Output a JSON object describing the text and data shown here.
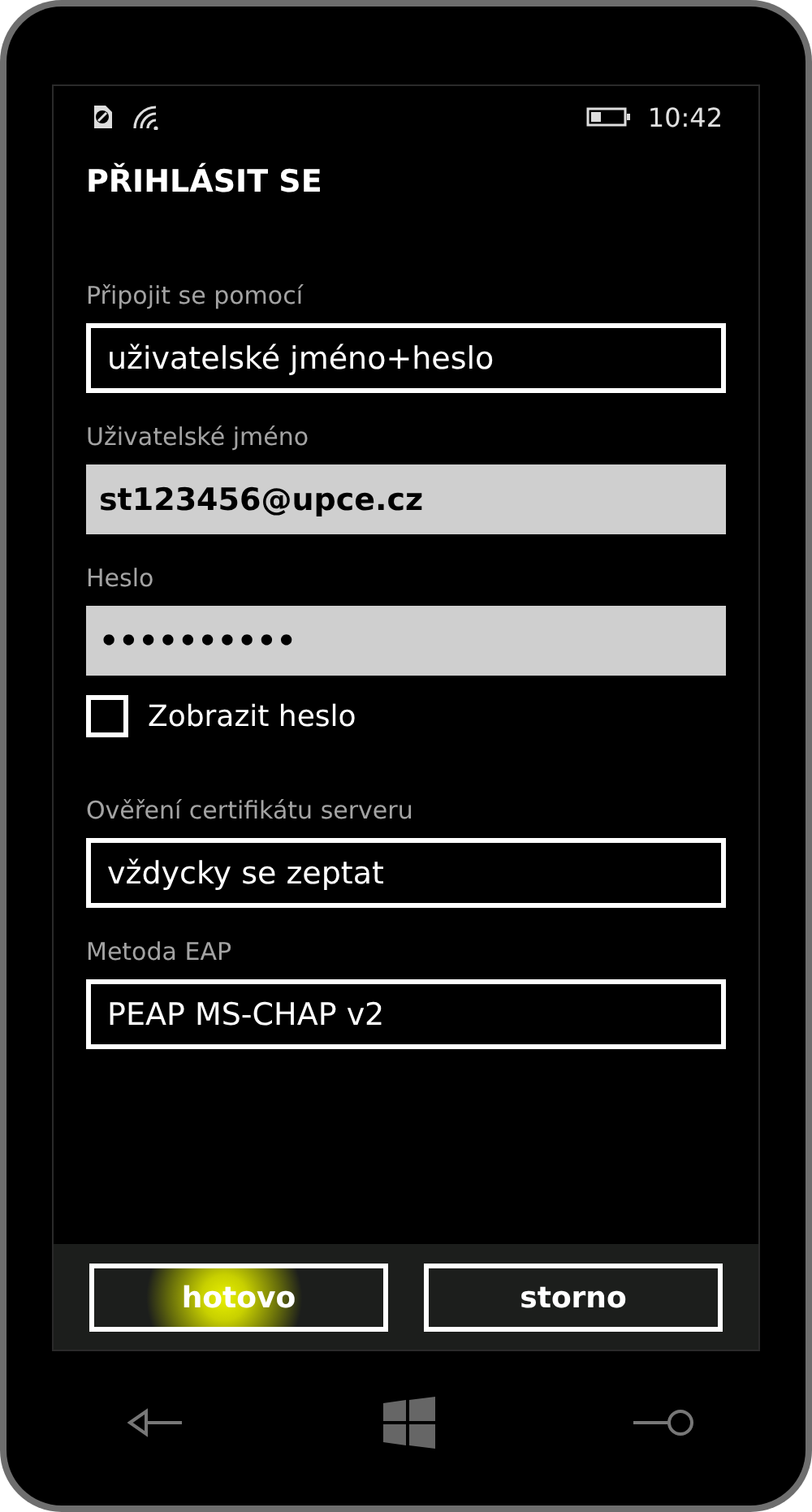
{
  "status_bar": {
    "time": "10:42"
  },
  "title": "PŘIHLÁSIT SE",
  "fields": [
    {
      "kind": "select",
      "label": "Připojit se pomocí",
      "value": "uživatelské jméno+heslo"
    },
    {
      "kind": "text",
      "label": "Uživatelské jméno",
      "value": "st123456@upce.cz"
    },
    {
      "kind": "password",
      "label": "Heslo",
      "value": "••••••••••"
    },
    {
      "kind": "checkbox",
      "label": "Zobrazit heslo",
      "checked": false
    },
    {
      "kind": "select",
      "label": "Ověření certifikátu serveru",
      "value": "vždycky se zeptat"
    },
    {
      "kind": "select",
      "label": "Metoda EAP",
      "value": "PEAP MS-CHAP v2"
    }
  ],
  "buttons": [
    {
      "label": "hotovo",
      "touched": true
    },
    {
      "label": "storno",
      "touched": false
    }
  ]
}
